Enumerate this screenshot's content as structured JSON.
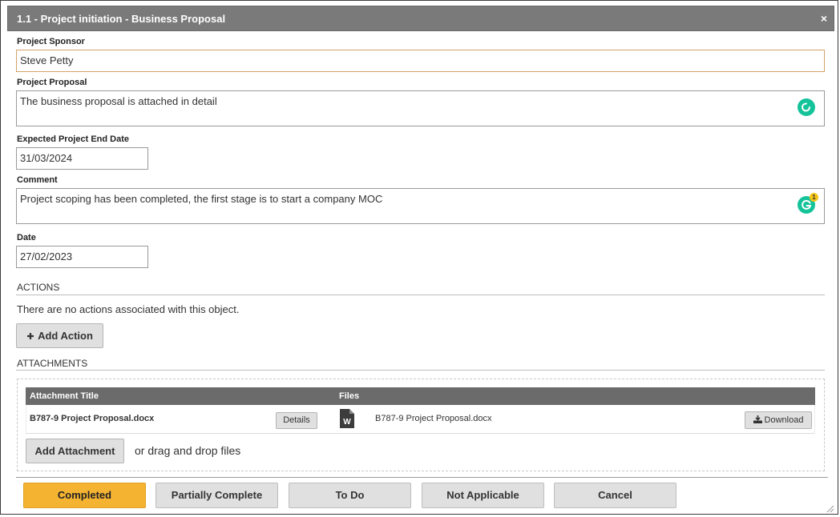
{
  "dialog": {
    "title": "1.1 - Project initiation - Business Proposal",
    "close_glyph": "×"
  },
  "fields": {
    "sponsor": {
      "label": "Project Sponsor",
      "value": "Steve Petty"
    },
    "proposal": {
      "label": "Project Proposal",
      "value": "The business proposal is attached in detail"
    },
    "end_date": {
      "label": "Expected Project End Date",
      "value": "31/03/2024"
    },
    "comment": {
      "label": "Comment",
      "value": "Project scoping has been completed, the first stage is to start a company MOC",
      "grammarly_badge": "1"
    },
    "date": {
      "label": "Date",
      "value": "27/02/2023"
    }
  },
  "actions": {
    "heading": "ACTIONS",
    "empty_text": "There are no actions associated with this object.",
    "add_label": "Add Action",
    "add_icon": "plus-icon"
  },
  "attachments": {
    "heading": "ATTACHMENTS",
    "columns": [
      "Attachment Title",
      "Files"
    ],
    "rows": [
      {
        "title": "B787-9 Project Proposal.docx",
        "details_label": "Details",
        "file_icon": "word-document-icon",
        "file_name": "B787-9 Project Proposal.docx",
        "download_label": "Download",
        "download_icon": "download-icon"
      }
    ],
    "add_label": "Add Attachment",
    "drop_hint": "or drag and drop files"
  },
  "footer": {
    "buttons": [
      "Completed",
      "Partially Complete",
      "To Do",
      "Not Applicable",
      "Cancel"
    ],
    "primary_color": "#f5b332"
  },
  "colors": {
    "titlebar": "#7a7a7a",
    "grammarly": "#15c39a",
    "table_header": "#6b6b6b"
  }
}
